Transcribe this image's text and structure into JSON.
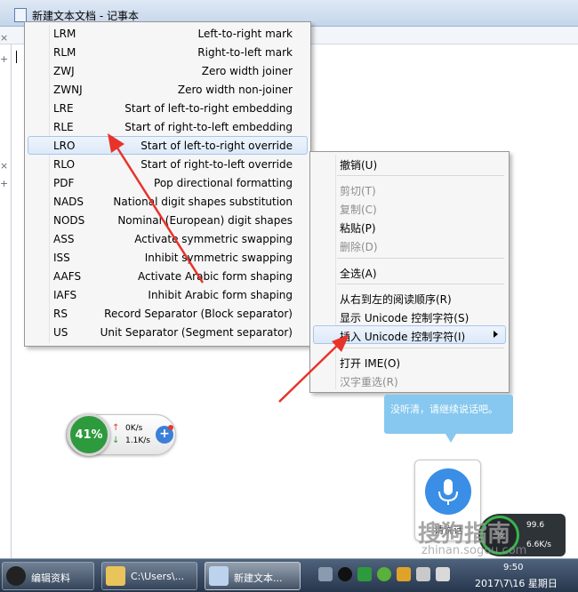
{
  "window": {
    "title": "新建文本文档 - 记事本"
  },
  "side_marks": [
    "×",
    "+",
    "×",
    "+"
  ],
  "unicode_submenu": {
    "items": [
      {
        "code": "LRM",
        "name": "Left-to-right mark"
      },
      {
        "code": "RLM",
        "name": "Right-to-left mark"
      },
      {
        "code": "ZWJ",
        "name": "Zero width joiner"
      },
      {
        "code": "ZWNJ",
        "name": "Zero width non-joiner"
      },
      {
        "code": "LRE",
        "name": "Start of left-to-right embedding"
      },
      {
        "code": "RLE",
        "name": "Start of right-to-left embedding"
      },
      {
        "code": "LRO",
        "name": "Start of left-to-right override"
      },
      {
        "code": "RLO",
        "name": "Start of right-to-left override"
      },
      {
        "code": "PDF",
        "name": "Pop directional formatting"
      },
      {
        "code": "NADS",
        "name": "National digit shapes substitution"
      },
      {
        "code": "NODS",
        "name": "Nominal (European) digit shapes"
      },
      {
        "code": "ASS",
        "name": "Activate symmetric swapping"
      },
      {
        "code": "ISS",
        "name": "Inhibit symmetric swapping"
      },
      {
        "code": "AAFS",
        "name": "Activate Arabic form shaping"
      },
      {
        "code": "IAFS",
        "name": "Inhibit Arabic form shaping"
      },
      {
        "code": "RS",
        "name": "Record Separator (Block separator)"
      },
      {
        "code": "US",
        "name": "Unit Separator (Segment separator)"
      }
    ],
    "highlighted_index": 6
  },
  "context_menu": {
    "undo": "撤销(U)",
    "cut": "剪切(T)",
    "copy": "复制(C)",
    "paste": "粘贴(P)",
    "delete": "删除(D)",
    "select_all": "全选(A)",
    "rtl_reading": "从右到左的阅读顺序(R)",
    "show_unicode": "显示 Unicode 控制字符(S)",
    "insert_unicode": "插入 Unicode 控制字符(I)",
    "open_ime": "打开 IME(O)",
    "reconversion": "汉字重选(R)"
  },
  "net_widget": {
    "percent": "41%",
    "upload": "0K/s",
    "download": "1.1K/s",
    "plus": "+",
    "ring_color": "#2e9a3e"
  },
  "voice": {
    "bubble": "没听清，请继续说话吧。",
    "button_label": "请说话"
  },
  "speed_widget": {
    "percent": "%",
    "upload": "99.6",
    "download": "6.6K/s"
  },
  "watermark": {
    "logo": "搜狗指南",
    "url": "zhinan.sogou.com"
  },
  "taskbar": {
    "items": [
      {
        "label": "编辑资料"
      },
      {
        "label": "C:\\Users\\..."
      },
      {
        "label": "新建文本..."
      }
    ],
    "time": "9:50",
    "date": "2017\\7\\16 星期日"
  },
  "colors": {
    "annotation_arrow": "#e8332a",
    "menu_highlight": "#dce9f8",
    "bubble": "#86c8ef",
    "mic": "#3a8ee6"
  }
}
